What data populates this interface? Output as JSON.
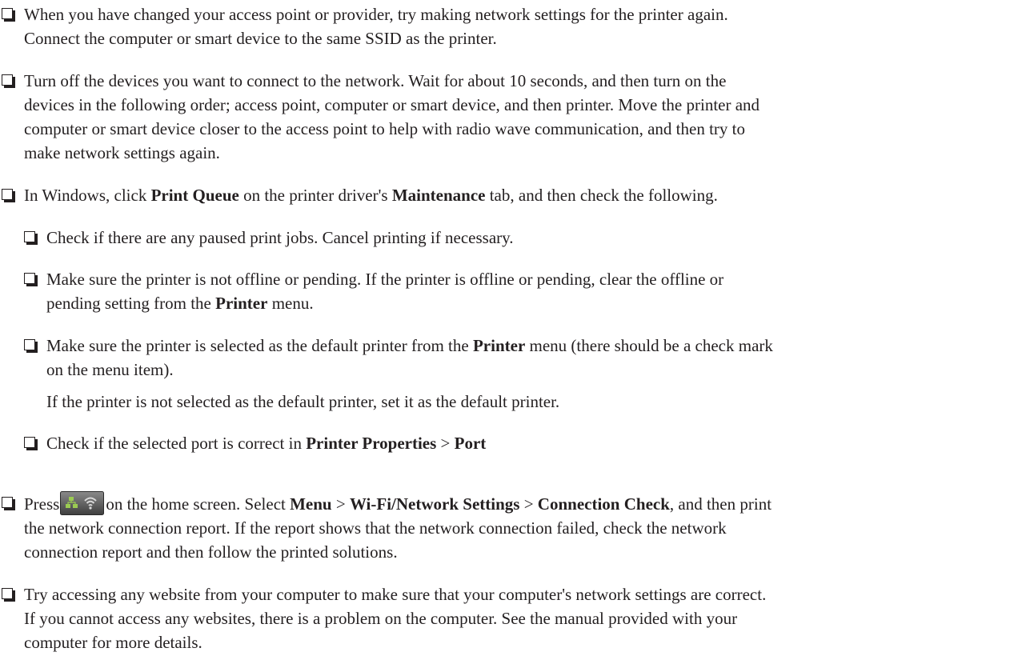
{
  "items": {
    "i1": {
      "line1": "When you have changed your access point or provider, try making network settings for the printer again.",
      "line2": "Connect the computer or smart device to the same SSID as the printer."
    },
    "i2": {
      "line1": "Turn off the devices you want to connect to the network. Wait for about 10 seconds, and then turn on the",
      "line2": "devices in the following order; access point, computer or smart device, and then printer. Move the printer and",
      "line3": "computer or smart device closer to the access point to help with radio wave communication, and then try to",
      "line4": "make network settings again."
    },
    "i3": {
      "t1": "In Windows, click ",
      "b1": "Print Queue",
      "t2": " on the printer driver's ",
      "b2": "Maintenance",
      "t3": " tab, and then check the following."
    },
    "i3a": {
      "text": "Check if there are any paused print jobs. Cancel printing if necessary."
    },
    "i3b": {
      "line1": "Make sure the printer is not offline or pending. If the printer is offline or pending, clear the offline or",
      "t1": "pending setting from the ",
      "b1": "Printer",
      "t2": " menu."
    },
    "i3c": {
      "t1": "Make sure the printer is selected as the default printer from the ",
      "b1": "Printer",
      "t2": " menu (there should be a check mark",
      "line2": "on the menu item).",
      "note": "If the printer is not selected as the default printer, set it as the default printer."
    },
    "i3d": {
      "t1": "Check if the selected port is correct in ",
      "b1": "Printer Properties",
      "t2": " > ",
      "b2": "Port"
    },
    "i4": {
      "t1": "Press",
      "t2": "on the home screen. Select ",
      "b1": "Menu",
      "t3": " > ",
      "b2": "Wi-Fi/Network Settings",
      "t4": " > ",
      "b3": "Connection Check",
      "t5": ", and then print",
      "line2": "the network connection report. If the report shows that the network connection failed, check the network",
      "line3": "connection report and then follow the printed solutions."
    },
    "i5": {
      "line1": "Try accessing any website from your computer to make sure that your computer's network settings are correct.",
      "line2": "If you cannot access any websites, there is a problem on the computer. See the manual provided with your",
      "line3": "computer for more details."
    }
  },
  "icons": {
    "checkbox": "checkbox-bullet-icon",
    "home_network": "network-status-icon"
  }
}
